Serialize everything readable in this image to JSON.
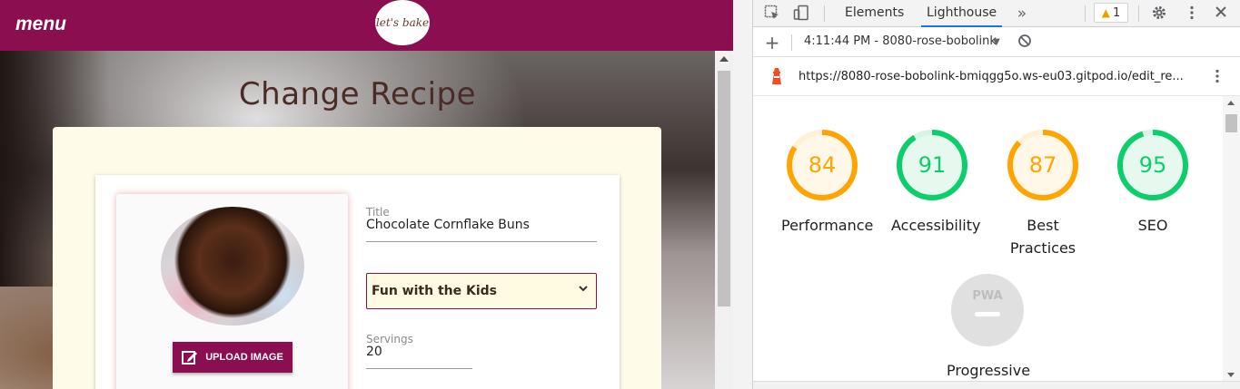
{
  "site": {
    "menu_label": "menu",
    "logo_text": "let's bake",
    "page_heading": "Change Recipe",
    "upload_button": "UPLOAD IMAGE",
    "fields": {
      "title_label": "Title",
      "title_value": "Chocolate Cornflake Buns",
      "category_value": "Fun with the Kids",
      "servings_label": "Servings",
      "servings_value": "20"
    }
  },
  "devtools": {
    "tabs": [
      "Elements",
      "Lighthouse"
    ],
    "active_tab": "Lighthouse",
    "warning_count": "1",
    "report_select": "4:11:44 PM - 8080-rose-bobolink",
    "url": "https://8080-rose-bobolink-bmiqgg5o.ws-eu03.gitpod.io/edit_re...",
    "scores": [
      {
        "label": "Performance",
        "value": "84",
        "color": "#ffa400"
      },
      {
        "label": "Accessibility",
        "value": "91",
        "color": "#0cce6b"
      },
      {
        "label": "Best Practices",
        "value": "87",
        "color": "#ffa400"
      },
      {
        "label": "SEO",
        "value": "95",
        "color": "#0cce6b"
      }
    ],
    "pwa": {
      "badge": "PWA",
      "label": "Progressive"
    }
  },
  "colors": {
    "brand": "#8a0e50",
    "accent_blue": "#1a73e8",
    "score_orange": "#ffa400",
    "score_green": "#0cce6b"
  },
  "icons": [
    "inspect-icon",
    "device-toolbar-icon",
    "more-tabs-icon",
    "warning-icon",
    "settings-icon",
    "kebab-menu-icon",
    "close-icon",
    "add-icon",
    "dropdown-icon",
    "clear-icon",
    "lighthouse-icon",
    "edit-icon",
    "chevron-down-icon"
  ]
}
